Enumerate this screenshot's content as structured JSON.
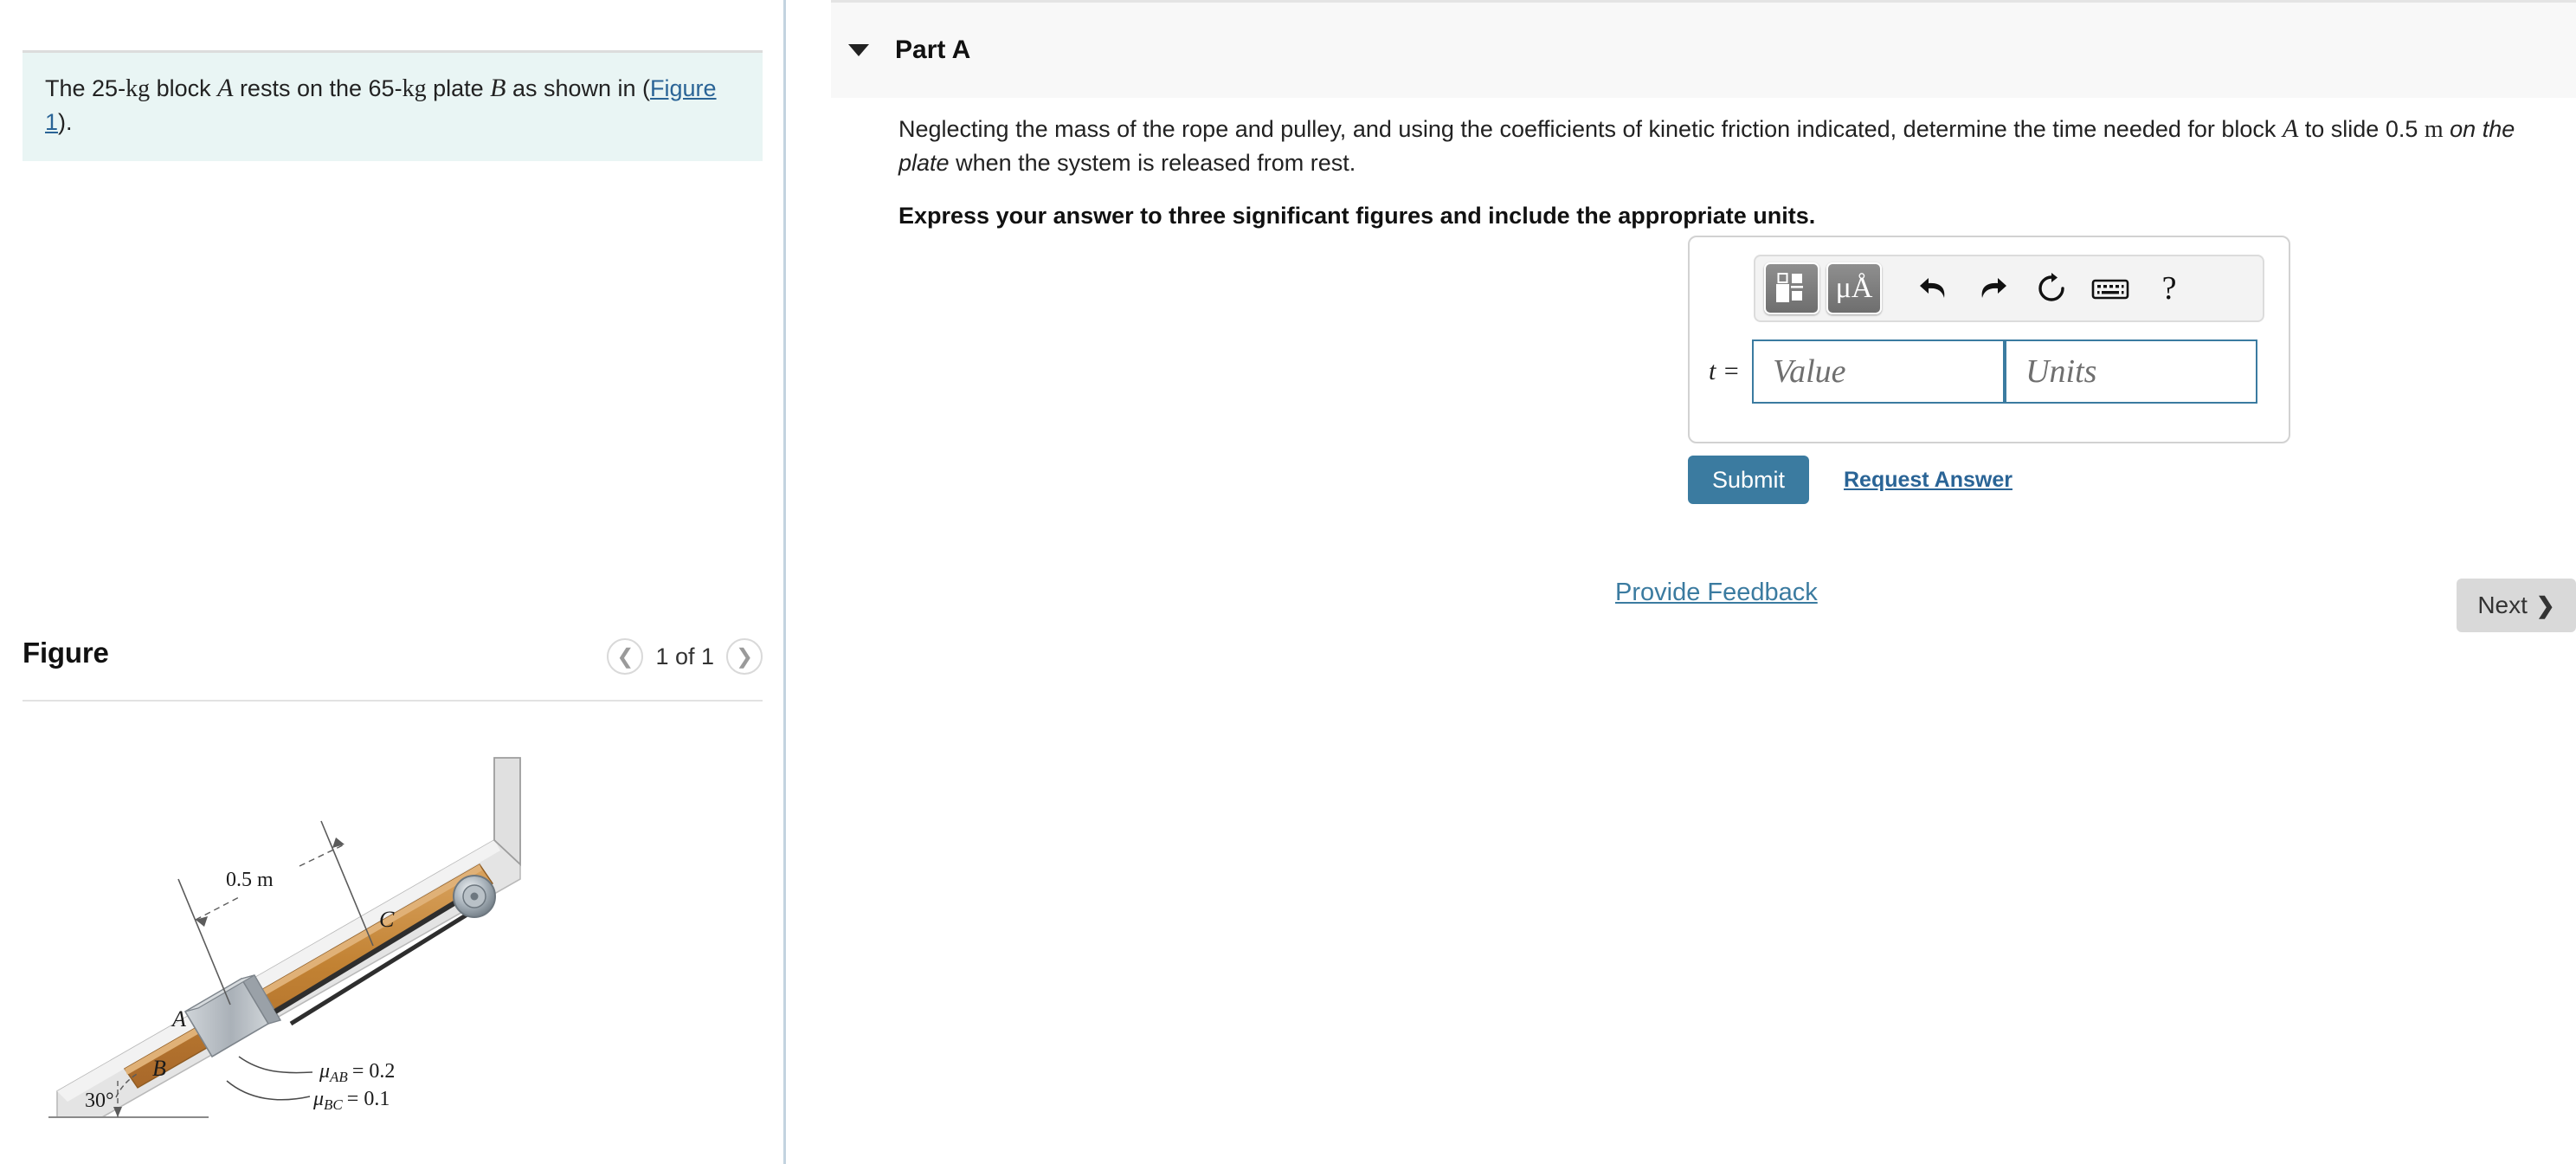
{
  "left": {
    "problem": {
      "prefix": "The ",
      "mass_a": "25-",
      "unit_kg_1": "kg",
      "mid1": " block ",
      "label_a": "A",
      "mid2": " rests on the ",
      "mass_b": "65-",
      "unit_kg_2": "kg",
      "mid3": " plate ",
      "label_b": "B",
      "suffix": " as shown in (",
      "figure_link": "Figure 1",
      "end": ")."
    },
    "figure": {
      "title": "Figure",
      "prev_icon": "chevron-left-icon",
      "count": "1 of 1",
      "next_icon": "chevron-right-icon",
      "diagram": {
        "dimension_label": "0.5 m",
        "block_label": "A",
        "plate_label": "B",
        "point_label": "C",
        "friction_ab": "μAB = 0.2",
        "friction_bc": "μBC = 0.1",
        "angle_label": "30°",
        "mu_ab_sym": "μ",
        "mu_ab_sub": "AB",
        "mu_ab_val": "= 0.2",
        "mu_bc_sym": "μ",
        "mu_bc_sub": "BC",
        "mu_bc_val": "= 0.1",
        "colors": {
          "incline_fill": "#e2e2e2",
          "plate_top": "#c98a43",
          "plate_body": "#b5762f",
          "block_fill": "#b9bec4",
          "rope": "#333333",
          "pulley": "#9aa4ab"
        }
      }
    }
  },
  "right": {
    "part": {
      "caret_icon": "caret-down-icon",
      "title": "Part A"
    },
    "question": {
      "line_1a": "Neglecting the mass of the rope and pulley, and using the coefficients of kinetic friction indicated, determine the time needed for block ",
      "block_label": "A",
      "line_1b": " to slide 0.5 ",
      "unit_m": "m",
      "line_1c": " ",
      "emphasis": "on the plate",
      "line_2": "when the system is released from rest.",
      "instruction": "Express your answer to three significant figures and include the appropriate units."
    },
    "answer": {
      "toolbar": {
        "template_icon": "math-template-icon",
        "units_icon": "micro-angstrom-units-icon",
        "units_label": "μÅ",
        "undo_icon": "undo-icon",
        "redo_icon": "redo-icon",
        "reset_icon": "reset-icon",
        "keyboard_icon": "keyboard-icon",
        "help_icon": "help-icon",
        "help_label": "?"
      },
      "variable_label": "t =",
      "value_placeholder": "Value",
      "units_placeholder": "Units",
      "value_current": "",
      "units_current": ""
    },
    "actions": {
      "submit_label": "Submit",
      "request_answer_label": "Request Answer",
      "provide_feedback_label": "Provide Feedback",
      "next_label": "Next",
      "next_chevron": "❯"
    }
  },
  "colors": {
    "accent_blue": "#3b7ba0",
    "link_blue": "#2a6496",
    "problem_bg": "#e9f5f4",
    "panel_bg": "#f8f8f8",
    "next_bg": "#d9d9d9"
  }
}
